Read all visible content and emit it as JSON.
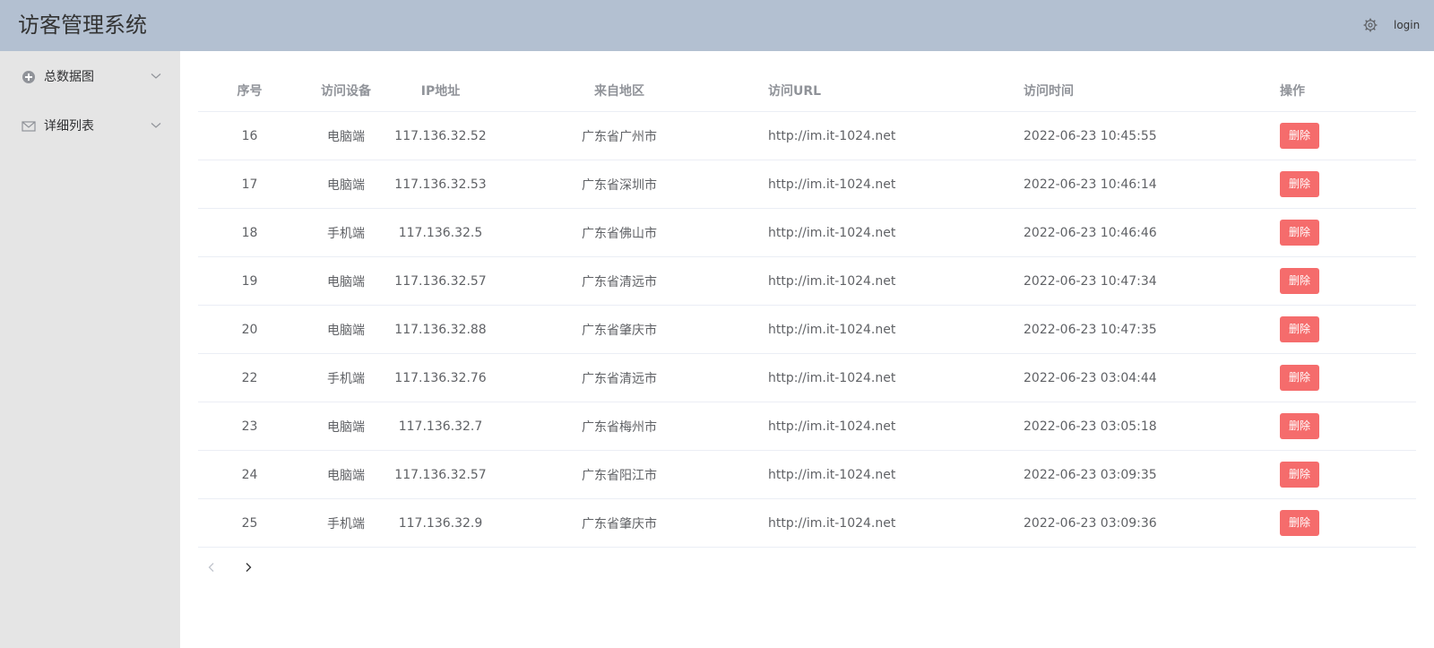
{
  "header": {
    "title": "访客管理系统",
    "settings_icon": "gear-icon",
    "login_label": "login"
  },
  "sidebar": {
    "items": [
      {
        "label": "总数据图",
        "icon": "circle-plus-icon"
      },
      {
        "label": "详细列表",
        "icon": "mail-icon"
      }
    ]
  },
  "table": {
    "columns": [
      "序号",
      "访问设备",
      "IP地址",
      "来自地区",
      "访问URL",
      "访问时间",
      "操作"
    ],
    "delete_label": "删除",
    "rows": [
      {
        "id": "16",
        "device": "电脑端",
        "ip": "117.136.32.52",
        "region": "广东省广州市",
        "url": "http://im.it-1024.net",
        "time": "2022-06-23 10:45:55"
      },
      {
        "id": "17",
        "device": "电脑端",
        "ip": "117.136.32.53",
        "region": "广东省深圳市",
        "url": "http://im.it-1024.net",
        "time": "2022-06-23 10:46:14"
      },
      {
        "id": "18",
        "device": "手机端",
        "ip": "117.136.32.5",
        "region": "广东省佛山市",
        "url": "http://im.it-1024.net",
        "time": "2022-06-23 10:46:46"
      },
      {
        "id": "19",
        "device": "电脑端",
        "ip": "117.136.32.57",
        "region": "广东省清远市",
        "url": "http://im.it-1024.net",
        "time": "2022-06-23 10:47:34"
      },
      {
        "id": "20",
        "device": "电脑端",
        "ip": "117.136.32.88",
        "region": "广东省肇庆市",
        "url": "http://im.it-1024.net",
        "time": "2022-06-23 10:47:35"
      },
      {
        "id": "22",
        "device": "手机端",
        "ip": "117.136.32.76",
        "region": "广东省清远市",
        "url": "http://im.it-1024.net",
        "time": "2022-06-23 03:04:44"
      },
      {
        "id": "23",
        "device": "电脑端",
        "ip": "117.136.32.7",
        "region": "广东省梅州市",
        "url": "http://im.it-1024.net",
        "time": "2022-06-23 03:05:18"
      },
      {
        "id": "24",
        "device": "电脑端",
        "ip": "117.136.32.57",
        "region": "广东省阳江市",
        "url": "http://im.it-1024.net",
        "time": "2022-06-23 03:09:35"
      },
      {
        "id": "25",
        "device": "手机端",
        "ip": "117.136.32.9",
        "region": "广东省肇庆市",
        "url": "http://im.it-1024.net",
        "time": "2022-06-23 03:09:36"
      }
    ]
  },
  "pagination": {
    "prev_icon": "chevron-left-icon",
    "next_icon": "chevron-right-icon"
  },
  "colors": {
    "header_bg": "#b3c0d1",
    "sidebar_bg": "#e5e5e5",
    "danger": "#f56c6c"
  }
}
